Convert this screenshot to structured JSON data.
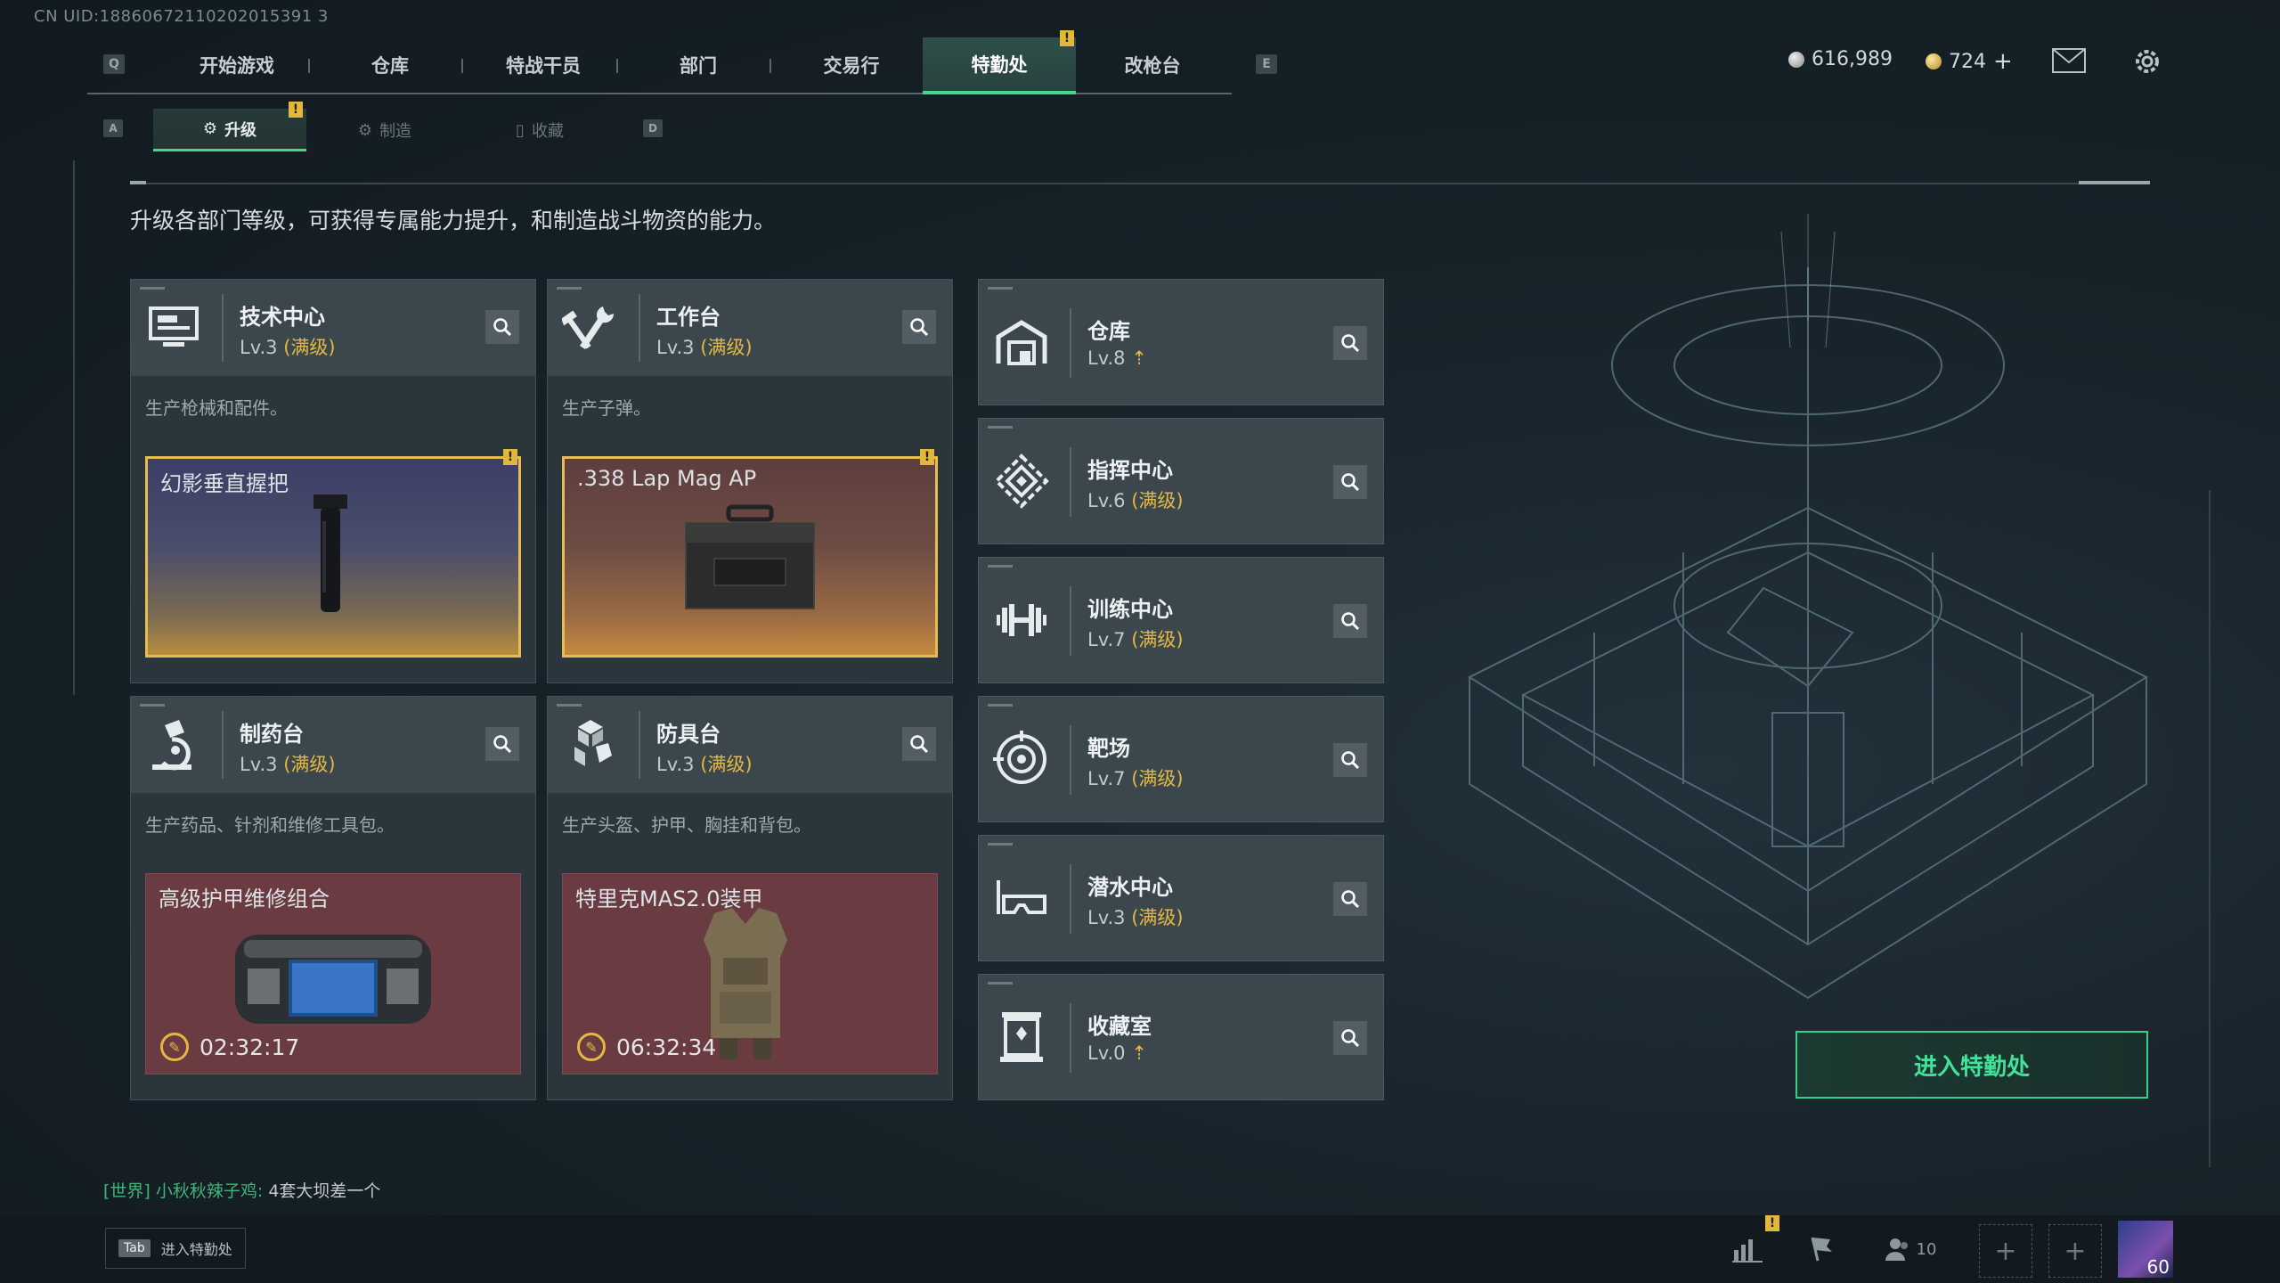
{
  "uid": "CN UID:18860672110202015391 3",
  "topnav": {
    "key_left": "Q",
    "key_right": "E",
    "tabs": [
      "开始游戏",
      "仓库",
      "特战干员",
      "部门",
      "交易行",
      "特勤处",
      "改枪台"
    ],
    "active": "特勤处",
    "badge": "!"
  },
  "currency": {
    "silver": "616,989",
    "gold": "724",
    "gold_plus": "+"
  },
  "subnav": {
    "key_left": "A",
    "key_right": "D",
    "tabs": [
      "升级",
      "制造",
      "收藏"
    ],
    "badge": "!"
  },
  "description": "升级各部门等级，可获得专属能力提升，和制造战斗物资的能力。",
  "cards": [
    {
      "title": "技术中心",
      "level": "Lv.3",
      "max": "(满级)",
      "desc": "生产枪械和配件。",
      "item": "幻影垂直握把",
      "badge": "!"
    },
    {
      "title": "工作台",
      "level": "Lv.3",
      "max": "(满级)",
      "desc": "生产子弹。",
      "item": ".338 Lap Mag AP",
      "badge": "!"
    },
    {
      "title": "制药台",
      "level": "Lv.3",
      "max": "(满级)",
      "desc": "生产药品、针剂和维修工具包。",
      "item": "高级护甲维修组合",
      "timer": "02:32:17"
    },
    {
      "title": "防具台",
      "level": "Lv.3",
      "max": "(满级)",
      "desc": "生产头盔、护甲、胸挂和背包。",
      "item": "特里克MAS2.0装甲",
      "timer": "06:32:34"
    }
  ],
  "side_cards": [
    {
      "title": "仓库",
      "level": "Lv.8",
      "max": ""
    },
    {
      "title": "指挥中心",
      "level": "Lv.6",
      "max": "(满级)"
    },
    {
      "title": "训练中心",
      "level": "Lv.7",
      "max": "(满级)"
    },
    {
      "title": "靶场",
      "level": "Lv.7",
      "max": "(满级)"
    },
    {
      "title": "潜水中心",
      "level": "Lv.3",
      "max": "(满级)"
    },
    {
      "title": "收藏室",
      "level": "Lv.0",
      "max": ""
    }
  ],
  "enter_button": "进入特勤处",
  "chat": {
    "channel": "[世界]",
    "user": "小秋秋辣子鸡:",
    "message": "4套大坝差一个"
  },
  "bottom": {
    "tab_key": "Tab",
    "tab_label": "进入特勤处",
    "friends": "10",
    "level": "60",
    "badge": "!"
  },
  "colors": {
    "accent": "#3fd88f",
    "gold": "#e5b842",
    "badge": "#e3b83a"
  }
}
